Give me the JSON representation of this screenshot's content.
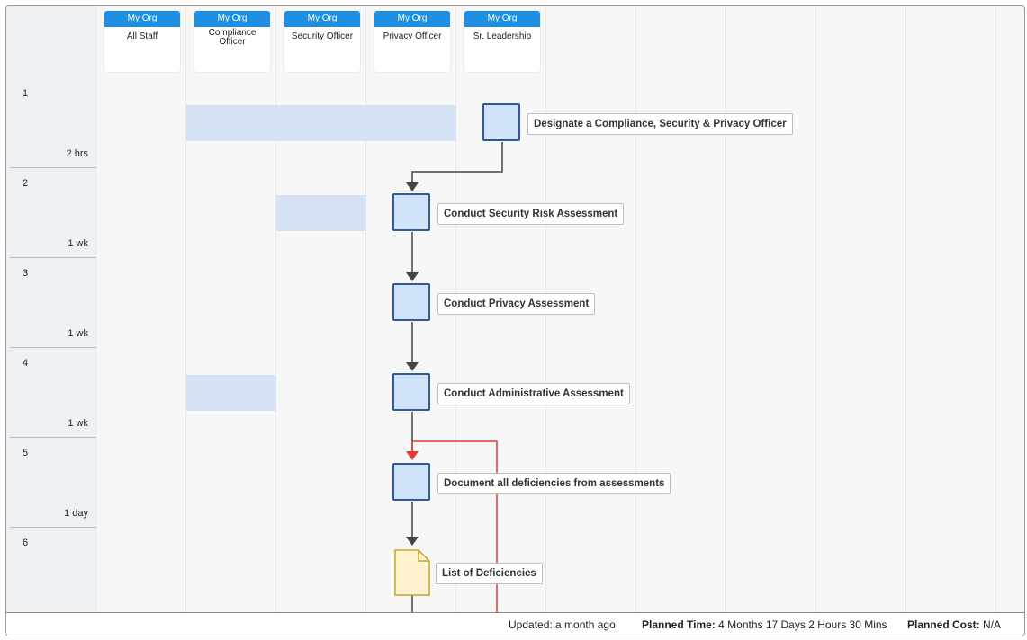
{
  "lanes": [
    {
      "org": "My Org",
      "title": "All Staff"
    },
    {
      "org": "My Org",
      "title": "Compliance\nOfficer"
    },
    {
      "org": "My Org",
      "title": "Security Officer"
    },
    {
      "org": "My Org",
      "title": "Privacy Officer"
    },
    {
      "org": "My Org",
      "title": "Sr. Leadership"
    }
  ],
  "rows": [
    {
      "number": "1",
      "duration": "2 hrs"
    },
    {
      "number": "2",
      "duration": "1 wk"
    },
    {
      "number": "3",
      "duration": "1 wk"
    },
    {
      "number": "4",
      "duration": "1 wk"
    },
    {
      "number": "5",
      "duration": "1 day"
    },
    {
      "number": "6",
      "duration": ""
    }
  ],
  "tasks": [
    {
      "label": "Designate a Compliance, Security & Privacy Officer"
    },
    {
      "label": "Conduct Security Risk Assessment"
    },
    {
      "label": "Conduct Privacy Assessment"
    },
    {
      "label": "Conduct Administrative Assessment"
    },
    {
      "label": "Document all deficiencies from assessments"
    },
    {
      "label": "List of Deficiencies"
    }
  ],
  "colors": {
    "lane_header": "#1e8fe1",
    "task_fill": "#d1e3fb",
    "task_border": "#2f5a9e",
    "participation_band": "#d6e2f5",
    "document_fill": "#fff3cf",
    "document_border": "#c9a227",
    "connector": "#444444",
    "loop_connector": "#e53935"
  },
  "footer": {
    "updated": "Updated: a month ago",
    "planned_time_label": "Planned Time:",
    "planned_time_value": "4 Months 17 Days 2 Hours 30 Mins",
    "planned_cost_label": "Planned Cost:",
    "planned_cost_value": "N/A"
  }
}
